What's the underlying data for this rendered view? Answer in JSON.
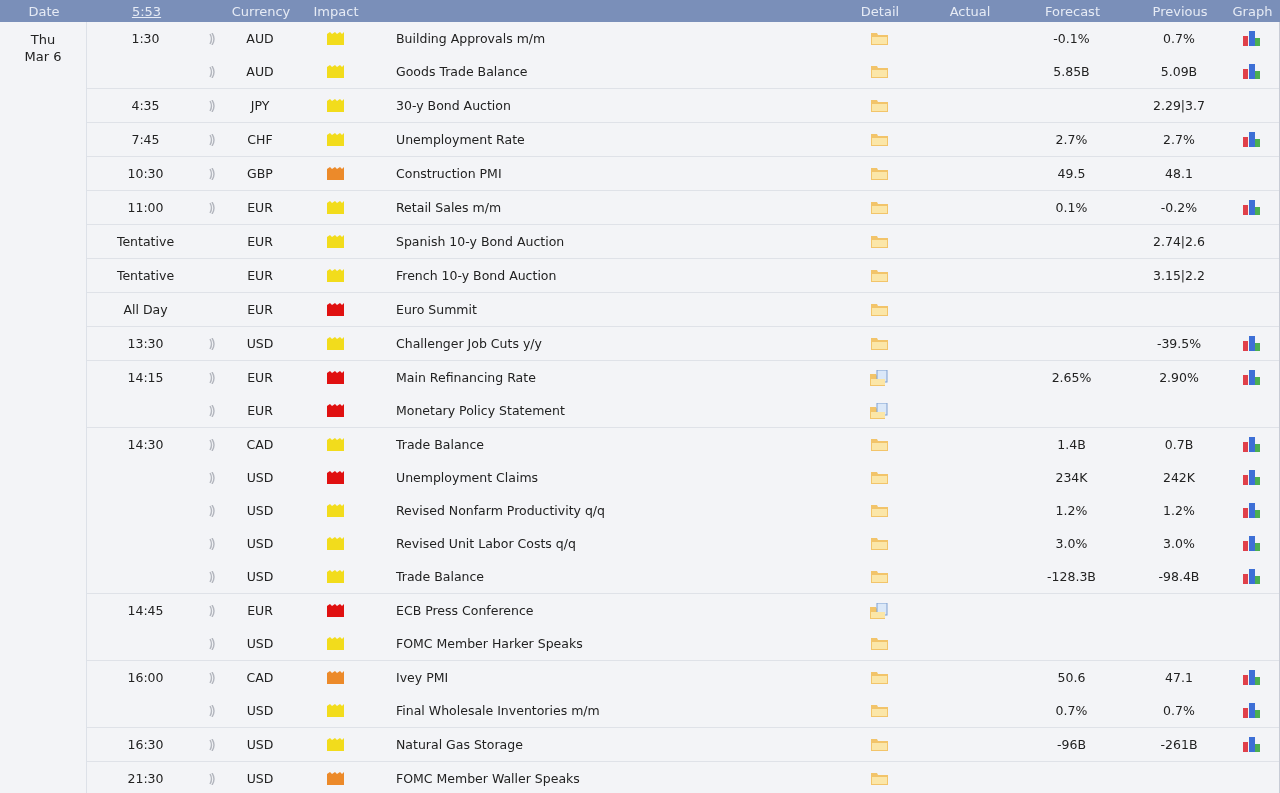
{
  "header": {
    "date": "Date",
    "time": "5:53",
    "currency": "Currency",
    "impact": "Impact",
    "detail": "Detail",
    "actual": "Actual",
    "forecast": "Forecast",
    "previous": "Previous",
    "graph": "Graph"
  },
  "day": {
    "weekday": "Thu",
    "date": "Mar 6"
  },
  "groups": [
    {
      "time": "1:30",
      "events": [
        {
          "alert": true,
          "currency": "AUD",
          "color": "#f2dc1c",
          "title": "Building Approvals m/m",
          "kind": "folder",
          "forecast": "-0.1%",
          "previous": "0.7%",
          "graph": true
        },
        {
          "alert": true,
          "currency": "AUD",
          "color": "#f2dc1c",
          "title": "Goods Trade Balance",
          "kind": "folder",
          "forecast": "5.85B",
          "previous": "5.09B",
          "graph": true
        }
      ]
    },
    {
      "time": "4:35",
      "events": [
        {
          "alert": true,
          "currency": "JPY",
          "color": "#f2dc1c",
          "title": "30-y Bond Auction",
          "kind": "folder",
          "previous": "2.29|3.7",
          "graph": false
        }
      ]
    },
    {
      "time": "7:45",
      "events": [
        {
          "alert": true,
          "currency": "CHF",
          "color": "#f2dc1c",
          "title": "Unemployment Rate",
          "kind": "folder",
          "forecast": "2.7%",
          "previous": "2.7%",
          "graph": true
        }
      ]
    },
    {
      "time": "10:30",
      "events": [
        {
          "alert": true,
          "currency": "GBP",
          "color": "#ec8a2a",
          "title": "Construction PMI",
          "kind": "folder",
          "forecast": "49.5",
          "previous": "48.1",
          "graph": false
        }
      ]
    },
    {
      "time": "11:00",
      "events": [
        {
          "alert": true,
          "currency": "EUR",
          "color": "#f2dc1c",
          "title": "Retail Sales m/m",
          "kind": "folder",
          "forecast": "0.1%",
          "previous": "-0.2%",
          "graph": true
        }
      ]
    },
    {
      "time": "Tentative",
      "events": [
        {
          "alert": false,
          "currency": "EUR",
          "color": "#f2dc1c",
          "title": "Spanish 10-y Bond Auction",
          "kind": "folder",
          "previous": "2.74|2.6",
          "graph": false
        }
      ]
    },
    {
      "time": "Tentative",
      "events": [
        {
          "alert": false,
          "currency": "EUR",
          "color": "#f2dc1c",
          "title": "French 10-y Bond Auction",
          "kind": "folder",
          "previous": "3.15|2.2",
          "graph": false
        }
      ]
    },
    {
      "time": "All Day",
      "events": [
        {
          "alert": false,
          "currency": "EUR",
          "color": "#e01010",
          "title": "Euro Summit",
          "kind": "folder",
          "graph": false
        }
      ]
    },
    {
      "time": "13:30",
      "events": [
        {
          "alert": true,
          "currency": "USD",
          "color": "#f2dc1c",
          "title": "Challenger Job Cuts y/y",
          "kind": "folder",
          "previous": "-39.5%",
          "graph": true
        }
      ]
    },
    {
      "time": "14:15",
      "events": [
        {
          "alert": true,
          "currency": "EUR",
          "color": "#e01010",
          "title": "Main Refinancing Rate",
          "kind": "folder-doc",
          "forecast": "2.65%",
          "previous": "2.90%",
          "graph": true
        },
        {
          "alert": true,
          "currency": "EUR",
          "color": "#e01010",
          "title": "Monetary Policy Statement",
          "kind": "folder-doc",
          "graph": false
        }
      ]
    },
    {
      "time": "14:30",
      "events": [
        {
          "alert": true,
          "currency": "CAD",
          "color": "#f2dc1c",
          "title": "Trade Balance",
          "kind": "folder",
          "forecast": "1.4B",
          "previous": "0.7B",
          "graph": true
        },
        {
          "alert": true,
          "currency": "USD",
          "color": "#e01010",
          "title": "Unemployment Claims",
          "kind": "folder",
          "forecast": "234K",
          "previous": "242K",
          "graph": true
        },
        {
          "alert": true,
          "currency": "USD",
          "color": "#f2dc1c",
          "title": "Revised Nonfarm Productivity q/q",
          "kind": "folder",
          "forecast": "1.2%",
          "previous": "1.2%",
          "graph": true
        },
        {
          "alert": true,
          "currency": "USD",
          "color": "#f2dc1c",
          "title": "Revised Unit Labor Costs q/q",
          "kind": "folder",
          "forecast": "3.0%",
          "previous": "3.0%",
          "graph": true
        },
        {
          "alert": true,
          "currency": "USD",
          "color": "#f2dc1c",
          "title": "Trade Balance",
          "kind": "folder",
          "forecast": "-128.3B",
          "previous": "-98.4B",
          "graph": true
        }
      ]
    },
    {
      "time": "14:45",
      "events": [
        {
          "alert": true,
          "currency": "EUR",
          "color": "#e01010",
          "title": "ECB Press Conference",
          "kind": "folder-doc",
          "graph": false
        },
        {
          "alert": true,
          "currency": "USD",
          "color": "#f2dc1c",
          "title": "FOMC Member Harker Speaks",
          "kind": "folder",
          "graph": false
        }
      ]
    },
    {
      "time": "16:00",
      "events": [
        {
          "alert": true,
          "currency": "CAD",
          "color": "#ec8a2a",
          "title": "Ivey PMI",
          "kind": "folder",
          "forecast": "50.6",
          "previous": "47.1",
          "graph": true
        },
        {
          "alert": true,
          "currency": "USD",
          "color": "#f2dc1c",
          "title": "Final Wholesale Inventories m/m",
          "kind": "folder",
          "forecast": "0.7%",
          "previous": "0.7%",
          "graph": true
        }
      ]
    },
    {
      "time": "16:30",
      "events": [
        {
          "alert": true,
          "currency": "USD",
          "color": "#f2dc1c",
          "title": "Natural Gas Storage",
          "kind": "folder",
          "forecast": "-96B",
          "previous": "-261B",
          "graph": true
        }
      ]
    },
    {
      "time": "21:30",
      "events": [
        {
          "alert": true,
          "currency": "USD",
          "color": "#ec8a2a",
          "title": "FOMC Member Waller Speaks",
          "kind": "folder",
          "graph": false
        }
      ]
    }
  ]
}
